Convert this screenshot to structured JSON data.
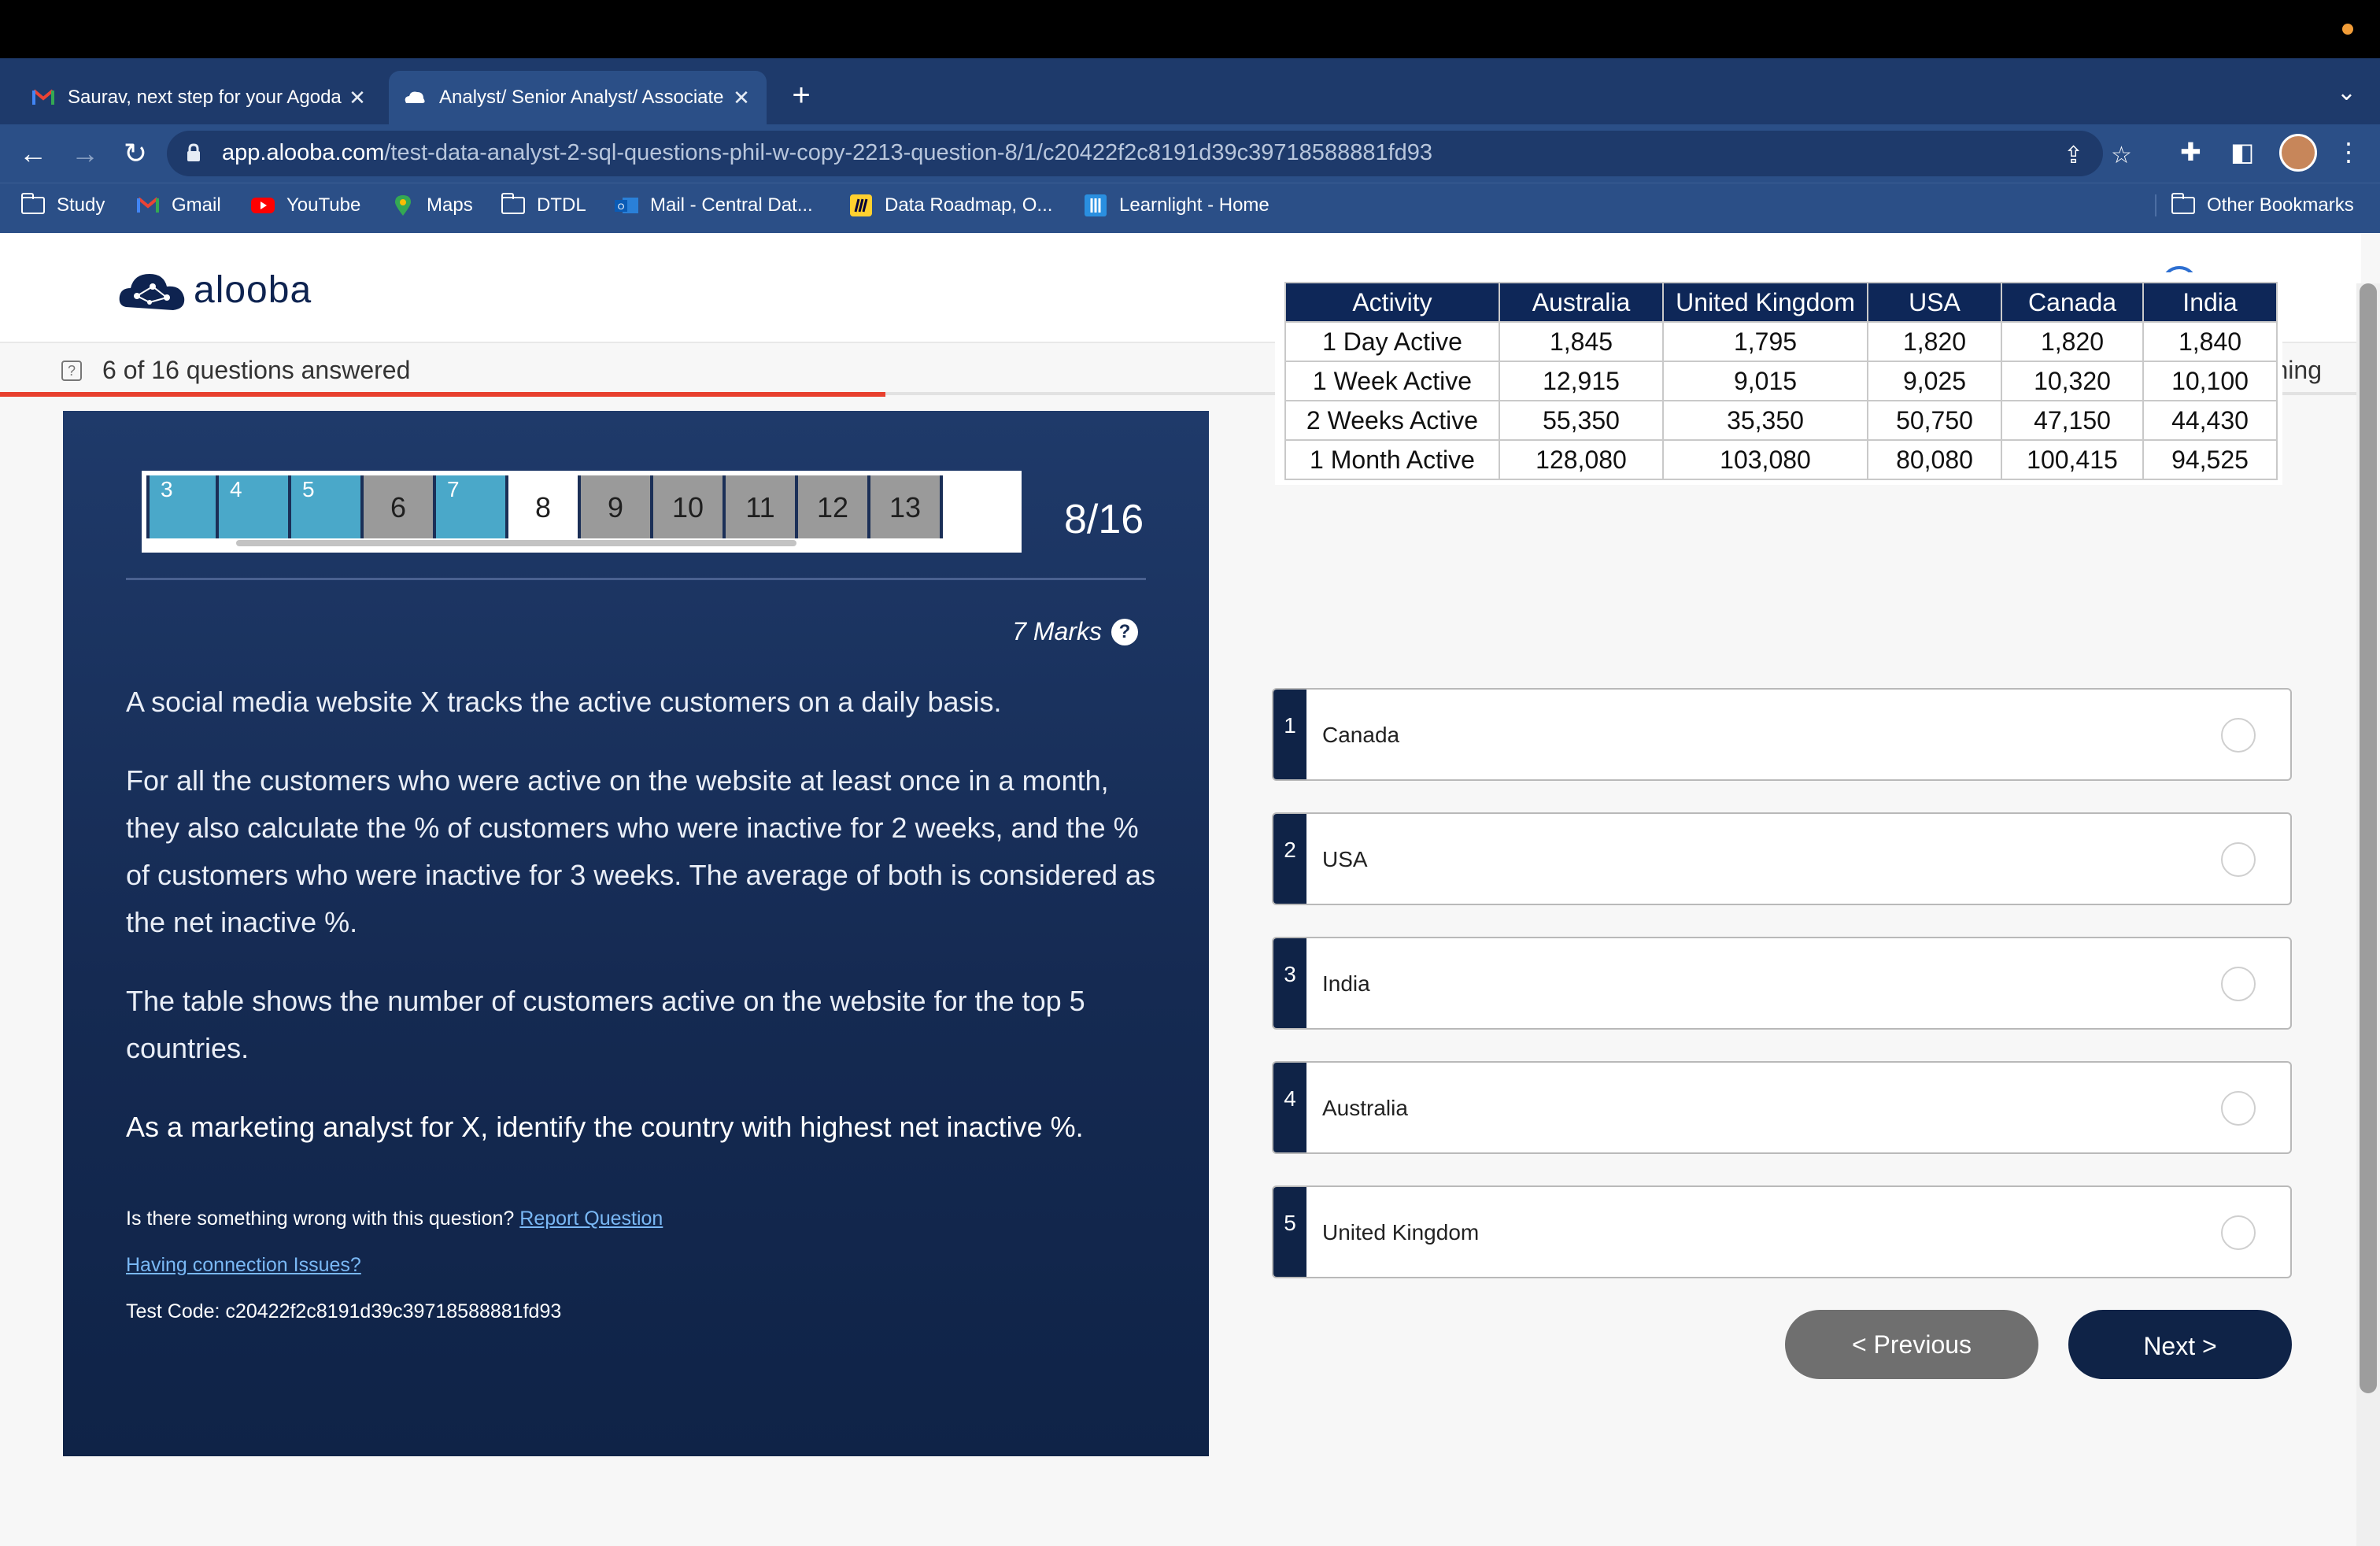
{
  "browser": {
    "tabs": [
      {
        "title": "Saurav, next step for your Agoda",
        "icon": "gmail-icon"
      },
      {
        "title": "Analyst/ Senior Analyst/ Associate",
        "icon": "alooba-icon"
      }
    ],
    "new_tab": "+",
    "url_host": "app.alooba.com",
    "url_path": "/test-data-analyst-2-sql-questions-phil-w-copy-2213-question-8/1/c20422f2c8191d39c39718588881fd93",
    "bookmarks": [
      {
        "label": "Study",
        "icon": "folder-icon"
      },
      {
        "label": "Gmail",
        "icon": "gmail-icon"
      },
      {
        "label": "YouTube",
        "icon": "youtube-icon"
      },
      {
        "label": "Maps",
        "icon": "maps-icon"
      },
      {
        "label": "DTDL",
        "icon": "folder-icon"
      },
      {
        "label": "Mail - Central Dat...",
        "icon": "outlook-icon"
      },
      {
        "label": "Data Roadmap, O...",
        "icon": "miro-icon"
      },
      {
        "label": "Learnlight - Home",
        "icon": "learnlight-icon"
      }
    ],
    "other_bookmarks": "Other Bookmarks"
  },
  "header": {
    "logo_text": "alooba",
    "help_symbol": "?"
  },
  "progress": {
    "answered_text": "6 of 16 questions answered",
    "remaining_text": "7 minutes remaining",
    "fraction_answered": 0.375,
    "bar_color": "#e8402e"
  },
  "question": {
    "nav_numbers": [
      "3",
      "4",
      "5",
      "6",
      "7",
      "8",
      "9",
      "10",
      "11",
      "12",
      "13"
    ],
    "count": "8/16",
    "marks": "7 Marks",
    "paragraph_1": "A social media website X tracks the active customers on a daily basis.",
    "paragraph_2": "For all the customers who were active on the website at least once in a month, they also calculate the % of customers who were inactive for 2 weeks, and the % of customers who were inactive for 3 weeks. The average of both is considered as the net inactive %.",
    "paragraph_3": "The table shows the number of customers active on the website for the top 5 countries.",
    "paragraph_4": "As a marketing analyst for X, identify the country with highest net inactive %.",
    "report_prompt": "Is there something wrong with this question?",
    "report_link": "Report Question",
    "connection_link": "Having connection Issues?",
    "test_code": "Test Code: c20422f2c8191d39c39718588881fd93"
  },
  "table": {
    "headers": [
      "Activity",
      "Australia",
      "United Kingdom",
      "USA",
      "Canada",
      "India"
    ],
    "rows": [
      [
        "1 Day Active",
        "1,845",
        "1,795",
        "1,820",
        "1,820",
        "1,840"
      ],
      [
        "1 Week Active",
        "12,915",
        "9,015",
        "9,025",
        "10,320",
        "10,100"
      ],
      [
        "2 Weeks Active",
        "55,350",
        "35,350",
        "50,750",
        "47,150",
        "44,430"
      ],
      [
        "1 Month Active",
        "128,080",
        "103,080",
        "80,080",
        "100,415",
        "94,525"
      ]
    ]
  },
  "options": [
    {
      "number": "1",
      "label": "Canada"
    },
    {
      "number": "2",
      "label": "USA"
    },
    {
      "number": "3",
      "label": "India"
    },
    {
      "number": "4",
      "label": "Australia"
    },
    {
      "number": "5",
      "label": "United Kingdom"
    }
  ],
  "buttons": {
    "previous": "< Previous",
    "next": "Next  >"
  },
  "colors": {
    "brand_navy": "#0f2347",
    "done_blue": "#4aa8c9",
    "skipped_gray": "#9a9a9a"
  }
}
